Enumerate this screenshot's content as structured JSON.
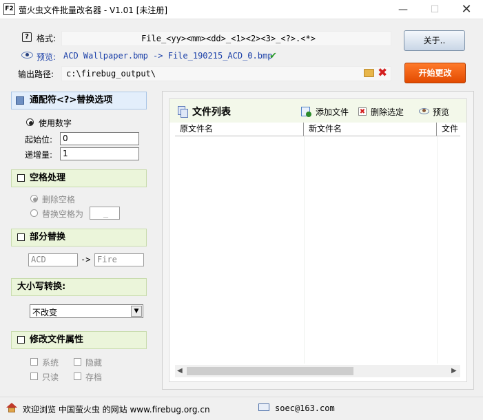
{
  "window": {
    "title": "萤火虫文件批量改名器 - V1.01  [未注册]",
    "icon_text": "F2"
  },
  "header": {
    "format_label": "格式:",
    "format_value": "File_<yy><mm><dd>_<1><2><3>_<?>.<*>",
    "preview_label": "预览:",
    "preview_value": "ACD Wallpaper.bmp -> File_190215_ACD_0.bmp",
    "output_label": "输出路径:",
    "output_value": "c:\\firebug_output\\",
    "about_button": "关于..",
    "start_button": "开始更改"
  },
  "wildcard": {
    "title": "通配符<?>替换选项",
    "use_numbers": "使用数字",
    "start_label": "起始位:",
    "start_value": "0",
    "step_label": "递增量:",
    "step_value": "1"
  },
  "spaces": {
    "title": "空格处理",
    "remove_label": "删除空格",
    "replace_label": "替换空格为",
    "replace_value": "_"
  },
  "partial": {
    "title": "部分替换",
    "from_value": "ACD",
    "arrow": "->",
    "to_value": "Fire"
  },
  "case": {
    "title": "大小写转换:",
    "selected": "不改变"
  },
  "attributes": {
    "title": "修改文件属性",
    "system": "系统",
    "hidden": "隐藏",
    "readonly": "只读",
    "archive": "存档"
  },
  "file_list": {
    "title": "文件列表",
    "add_files": "添加文件",
    "remove_selected": "删除选定",
    "preview": "预览",
    "columns": [
      "原文件名",
      "新文件名",
      "文件"
    ]
  },
  "status": {
    "welcome": "欢迎浏览  中国萤火虫 的网站 www.firebug.org.cn",
    "email": "soec@163.com"
  },
  "colors": {
    "accent_orange": "#e85a0c",
    "preview_blue": "#1a3fa8",
    "panel_green": "#ebf5da",
    "panel_blue": "#e3eefb"
  }
}
